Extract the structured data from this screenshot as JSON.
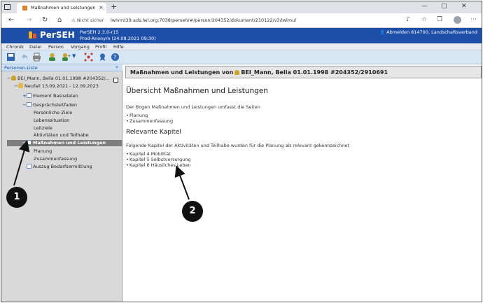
{
  "browser": {
    "tab_title": "Maßnahmen und Leistungen - Pe",
    "tab_close": "×",
    "new_tab": "+",
    "security": "Nicht sicher",
    "url": "lwlvmt39.ads.lwl.org:7038/perseh/#/person/204352/dokument/210122/v3/lwlmul"
  },
  "app": {
    "name": "PerSEH",
    "version": "PerSEH 2.3.0-r15",
    "environment": "Prod-Anonym (24.08.2021 09:30)",
    "logout": "Abmelden 814700, Landschaftsverband",
    "brand_color": "#1d4ea8"
  },
  "menu": [
    "Chronik",
    "Datei",
    "Person",
    "Vorgang",
    "Profil",
    "Hilfe"
  ],
  "sidebar": {
    "title": "Personen-Liste",
    "collapse": "«",
    "items": [
      {
        "label": "BEI_Mann, Bella 01.01.1998 #204352/...",
        "icon": "person-icon",
        "toggle": "−"
      },
      {
        "label": "Neufall 13.09.2021 - 12.09.2023",
        "icon": "folder-icon",
        "toggle": "−"
      },
      {
        "label": "Element Basisdaten",
        "icon": "document-icon",
        "toggle": "+"
      },
      {
        "label": "Gesprächsleitfaden",
        "icon": "document-icon",
        "toggle": "−"
      },
      {
        "label": "Persönliche Ziele"
      },
      {
        "label": "Lebenssituation"
      },
      {
        "label": "Leitziele"
      },
      {
        "label": "Aktivitäten und Teilhabe"
      },
      {
        "label": "Maßnahmen und Leistungen",
        "icon": "document-icon",
        "toggle": "−",
        "selected": true
      },
      {
        "label": "Planung"
      },
      {
        "label": "Zusammenfassung"
      },
      {
        "label": "Auszug Bedarfsermittlung",
        "icon": "document-icon"
      }
    ]
  },
  "content": {
    "header_prefix": "Maßnahmen und Leistungen von",
    "header_person": "BEI_Mann, Bella 01.01.1998 #204352/2910691",
    "heading": "Übersicht Maßnahmen und Leistungen",
    "intro": "Der Bogen Maßnahmen und Leistungen umfasst die Seiten",
    "pages": [
      "Planung",
      "Zusammenfassung"
    ],
    "subheading": "Relevante Kapitel",
    "chapters_intro": "Folgende Kapitel der Aktivitäten und Teilhabe wurden für die Planung als relevant gekennzeichnet",
    "chapters": [
      "Kapitel 4 Mobilität",
      "Kapitel 5 Selbstversorgung",
      "Kapitel 6 Häusliches Leben"
    ]
  },
  "callouts": [
    "1",
    "2"
  ]
}
